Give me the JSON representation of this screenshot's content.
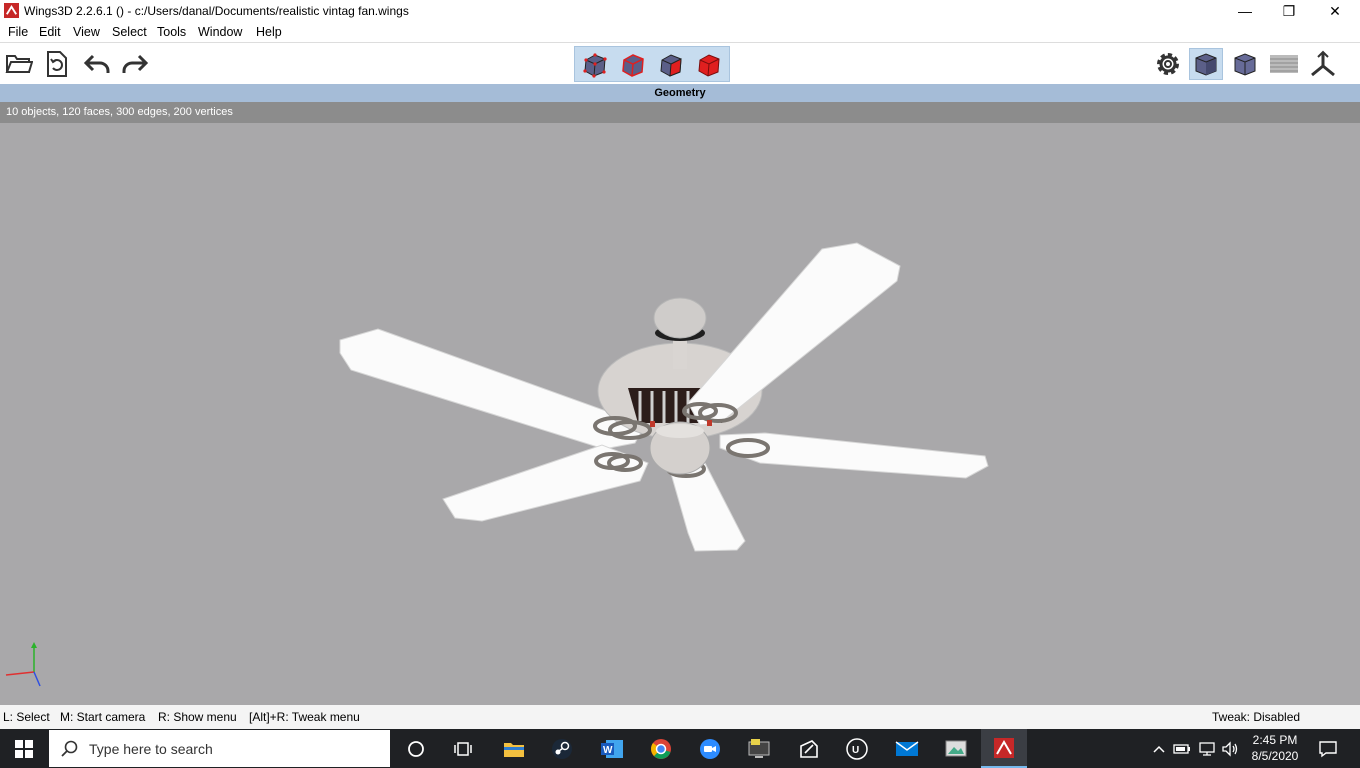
{
  "window": {
    "title": "Wings3D 2.2.6.1 () - c:/Users/danal/Documents/realistic vintag fan.wings",
    "minimize": "—",
    "maximize": "❐",
    "close": "✕"
  },
  "menu": [
    "File",
    "Edit",
    "View",
    "Select",
    "Tools",
    "Window",
    "Help"
  ],
  "toolbar": {
    "left_icons": [
      "open-folder-icon",
      "save-icon",
      "undo-icon",
      "redo-icon"
    ],
    "select_modes": [
      "vertex-select-icon",
      "edge-select-icon",
      "face-select-icon",
      "object-select-icon"
    ],
    "right_icons": [
      "settings-gear-icon",
      "smooth-shaded-icon",
      "flat-shaded-icon",
      "ground-grid-icon",
      "axes-icon"
    ]
  },
  "geometry_header": "Geometry",
  "info": "10 objects, 120 faces, 300 edges, 200 vertices",
  "status": {
    "left_select": "L: Select",
    "start_camera": "M: Start camera",
    "show_menu": "R: Show menu",
    "tweak_menu": "[Alt]+R: Tweak menu",
    "tweak": "Tweak: Disabled"
  },
  "taskbar": {
    "search_placeholder": "Type here to search",
    "time": "2:45 PM",
    "date": "8/5/2020"
  },
  "colors": {
    "viewport_bg": "#a9a8aa",
    "header_bg": "#a5bcd7",
    "info_bg": "#8c8c8c",
    "select_red": "#e01f1f"
  }
}
